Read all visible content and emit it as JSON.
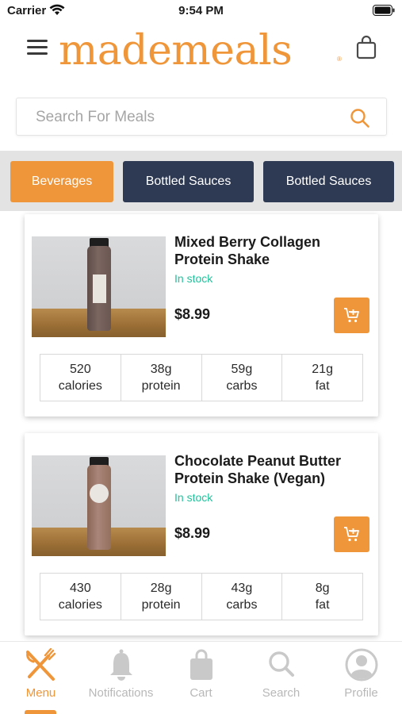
{
  "status_bar": {
    "carrier": "Carrier",
    "time": "9:54 PM"
  },
  "header": {
    "logo_text": "mademeals",
    "logo_mark": "®"
  },
  "search": {
    "placeholder": "Search For Meals"
  },
  "categories": [
    {
      "label": "Beverages",
      "active": true
    },
    {
      "label": "Bottled Sauces",
      "active": false
    },
    {
      "label": "Bottled Sauces",
      "active": false
    }
  ],
  "products": [
    {
      "title": "Mixed Berry Collagen Protein Shake",
      "stock": "In stock",
      "price": "$8.99",
      "nutrition": [
        {
          "value": "520",
          "unit": "calories"
        },
        {
          "value": "38g",
          "unit": "protein"
        },
        {
          "value": "59g",
          "unit": "carbs"
        },
        {
          "value": "21g",
          "unit": "fat"
        }
      ]
    },
    {
      "title": "Chocolate Peanut Butter Protein Shake (Vegan)",
      "stock": "In stock",
      "price": "$8.99",
      "nutrition": [
        {
          "value": "430",
          "unit": "calories"
        },
        {
          "value": "28g",
          "unit": "protein"
        },
        {
          "value": "43g",
          "unit": "carbs"
        },
        {
          "value": "8g",
          "unit": "fat"
        }
      ]
    }
  ],
  "tabs": [
    {
      "label": "Menu",
      "icon": "fork-knife-icon",
      "active": true
    },
    {
      "label": "Notifications",
      "icon": "bell-icon",
      "active": false
    },
    {
      "label": "Cart",
      "icon": "shopping-bag-icon",
      "active": false
    },
    {
      "label": "Search",
      "icon": "search-icon",
      "active": false
    },
    {
      "label": "Profile",
      "icon": "profile-icon",
      "active": false
    }
  ],
  "colors": {
    "accent": "#f0963a",
    "navy": "#2e3a53",
    "in_stock": "#1ec39b",
    "inactive_tab": "#b8b8b8"
  }
}
